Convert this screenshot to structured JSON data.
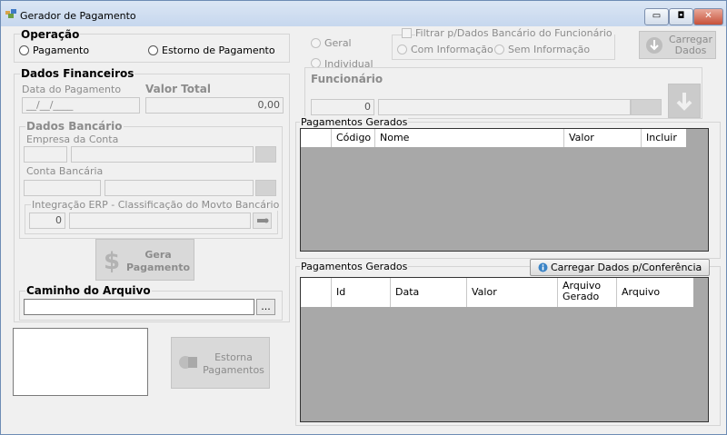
{
  "window": {
    "title": "Gerador de Pagamento",
    "buttons": {
      "minimize": "▭",
      "maximize": "◘",
      "close": "✕"
    }
  },
  "operacao": {
    "title": "Operação",
    "options": [
      "Pagamento",
      "Estorno de Pagamento"
    ]
  },
  "filtro": {
    "geral": "Geral",
    "individual": "Individual",
    "filtrar_label": "Filtrar p/Dados Bancário do Funcionário",
    "com_informacao": "Com Informação",
    "sem_informacao": "Sem Informação",
    "carregar_label": "Carregar Dados"
  },
  "dados_financeiros": {
    "title": "Dados Financeiros",
    "data_pagamento_label": "Data do Pagamento",
    "data_pagamento_value": "__/__/____",
    "valor_total_label": "Valor Total",
    "valor_total_value": "0,00"
  },
  "dados_bancario": {
    "title": "Dados Bancário",
    "empresa_label": "Empresa da Conta",
    "conta_label": "Conta Bancária",
    "integracao_label": "Integração ERP - Classificação do Movto Bancário",
    "integracao_value": "0"
  },
  "funcionario": {
    "title": "Funcionário",
    "code_value": "0"
  },
  "gera_pagamento": "Gera Pagamento",
  "caminho": {
    "title": "Caminho do Arquivo",
    "value": "",
    "browse": "..."
  },
  "estorna_pagamentos": "Estorna Pagamentos",
  "grid1": {
    "title": "Pagamentos Gerados",
    "columns": [
      "Código",
      "Nome",
      "Valor",
      "Incluir"
    ]
  },
  "grid2": {
    "title": "Pagamentos Gerados",
    "load_button": "Carregar Dados p/Conferência",
    "columns": [
      "Id",
      "Data",
      "Valor",
      "Arquivo Gerado",
      "Arquivo"
    ]
  }
}
